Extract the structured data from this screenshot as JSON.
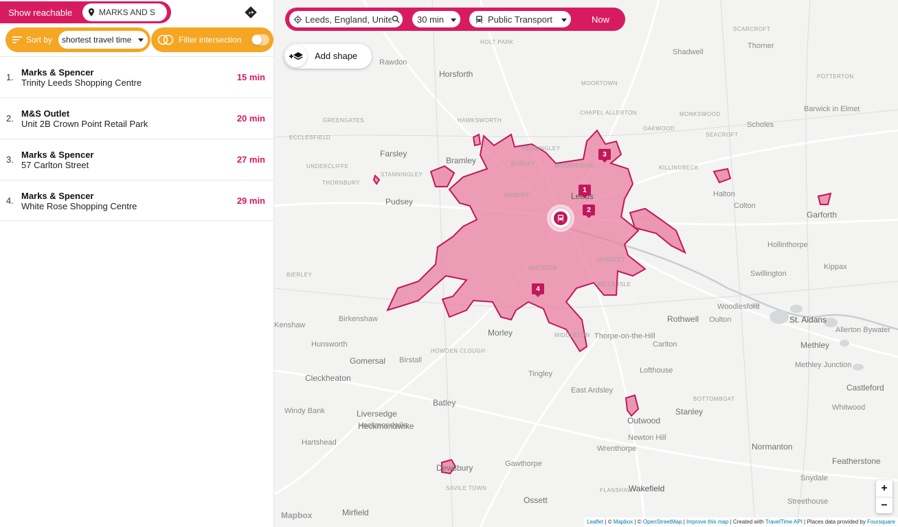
{
  "sidebar": {
    "reachable_label": "Show reachable",
    "poi_query": "MARKS AND S",
    "sort_label": "Sort by",
    "sort_value": "shortest travel time",
    "filter_label": "Filter intersection",
    "results": [
      {
        "index": "1.",
        "name": "Marks & Spencer",
        "address": "Trinity Leeds Shopping Centre",
        "time": "15 min"
      },
      {
        "index": "2.",
        "name": "M&S Outlet",
        "address": "Unit 2B Crown Point Retail Park",
        "time": "20 min"
      },
      {
        "index": "3.",
        "name": "Marks & Spencer",
        "address": "57 Carlton Street",
        "time": "27 min"
      },
      {
        "index": "4.",
        "name": "Marks & Spencer",
        "address": "White Rose Shopping Centre",
        "time": "29 min"
      }
    ]
  },
  "topbar": {
    "location": "Leeds, England, United",
    "time": "30 min",
    "mode": "Public Transport",
    "now_label": "Now"
  },
  "map": {
    "add_shape_label": "Add shape",
    "zoom_in": "+",
    "zoom_out": "−",
    "mapbox_logo": "Mapbox",
    "markers": [
      "1",
      "2",
      "3",
      "4"
    ],
    "labels": [
      {
        "t": "Horsforth",
        "c": "town"
      },
      {
        "t": "Farsley",
        "c": "town"
      },
      {
        "t": "Bramley",
        "c": "town"
      },
      {
        "t": "Pudsey",
        "c": "town"
      },
      {
        "t": "Leeds",
        "c": "big"
      },
      {
        "t": "Morley",
        "c": "town"
      },
      {
        "t": "Rothwell",
        "c": "town"
      },
      {
        "t": "Garforth",
        "c": "town"
      },
      {
        "t": "Gomersal",
        "c": "town"
      },
      {
        "t": "Cleckheaton",
        "c": "town"
      },
      {
        "t": "Batley",
        "c": "town"
      },
      {
        "t": "Liversedge",
        "c": "town"
      },
      {
        "t": "Heckmondwike",
        "c": "town"
      },
      {
        "t": "Dewsbury",
        "c": "town"
      },
      {
        "t": "Mirfield",
        "c": "town"
      },
      {
        "t": "Ossett",
        "c": "town"
      },
      {
        "t": "Wakefield",
        "c": "big"
      },
      {
        "t": "Outwood",
        "c": "town"
      },
      {
        "t": "Stanley",
        "c": "town"
      },
      {
        "t": "Normanton",
        "c": "town"
      },
      {
        "t": "Castleford",
        "c": "town"
      },
      {
        "t": "Featherstone",
        "c": "town"
      },
      {
        "t": "Methley",
        "c": "town"
      },
      {
        "t": "St. Aidans",
        "c": "big"
      },
      {
        "t": "Birkenshaw",
        "c": ""
      },
      {
        "t": "Hunsworth",
        "c": ""
      },
      {
        "t": "Birstall",
        "c": ""
      },
      {
        "t": "Tingley",
        "c": ""
      },
      {
        "t": "East Ardsley",
        "c": ""
      },
      {
        "t": "Carlton",
        "c": ""
      },
      {
        "t": "Lofthouse",
        "c": ""
      },
      {
        "t": "Thorpe-on-the-Hill",
        "c": ""
      },
      {
        "t": "Oulton",
        "c": ""
      },
      {
        "t": "Woodlesford",
        "c": ""
      },
      {
        "t": "Swillington",
        "c": ""
      },
      {
        "t": "Kippax",
        "c": ""
      },
      {
        "t": "Colton",
        "c": ""
      },
      {
        "t": "Halton",
        "c": ""
      },
      {
        "t": "Scholes",
        "c": ""
      },
      {
        "t": "Barwick in Elmet",
        "c": ""
      },
      {
        "t": "Shadwell",
        "c": ""
      },
      {
        "t": "Thorner",
        "c": ""
      },
      {
        "t": "Rawdon",
        "c": ""
      },
      {
        "t": "Hollinthorpe",
        "c": ""
      },
      {
        "t": "Allerton Bywater",
        "c": ""
      },
      {
        "t": "Whitwood",
        "c": ""
      },
      {
        "t": "Snydale",
        "c": ""
      },
      {
        "t": "Streethouse",
        "c": ""
      },
      {
        "t": "Gawthorpe",
        "c": ""
      },
      {
        "t": "Wrenthorpe",
        "c": ""
      },
      {
        "t": "Newton Hill",
        "c": ""
      },
      {
        "t": "Windy Bank",
        "c": ""
      },
      {
        "t": "Hartshead",
        "c": ""
      },
      {
        "t": "Thornbury",
        "c": "district"
      },
      {
        "t": "Stanningley",
        "c": "district"
      },
      {
        "t": "Armley",
        "c": "district"
      },
      {
        "t": "Burley",
        "c": "district"
      },
      {
        "t": "Headingley",
        "c": "district"
      },
      {
        "t": "Beeston",
        "c": "district"
      },
      {
        "t": "Hunslet",
        "c": "district"
      },
      {
        "t": "Belle Isle",
        "c": "district"
      },
      {
        "t": "Middleton",
        "c": "district"
      },
      {
        "t": "Ecclesfield",
        "c": "district"
      },
      {
        "t": "Undercliffe",
        "c": "district"
      },
      {
        "t": "Greengates",
        "c": "district"
      },
      {
        "t": "Hawksworth",
        "c": "district"
      },
      {
        "t": "Moortown",
        "c": "district"
      },
      {
        "t": "Oakwood",
        "c": "district"
      },
      {
        "t": "Seacroft",
        "c": "district"
      },
      {
        "t": "Monkswood",
        "c": "district"
      },
      {
        "t": "Killingbeck",
        "c": "district"
      },
      {
        "t": "Bierley",
        "c": "district"
      },
      {
        "t": "Howden Clough",
        "c": "district"
      },
      {
        "t": "Bottomboat",
        "c": "district"
      },
      {
        "t": "Flanshaw",
        "c": "district"
      },
      {
        "t": "Savile Town",
        "c": "district"
      },
      {
        "t": "Scarcroft",
        "c": "district"
      },
      {
        "t": "Potterton",
        "c": "district"
      },
      {
        "t": "Chapel Allerton",
        "c": "district"
      },
      {
        "t": "Holt Park",
        "c": "district"
      },
      {
        "t": "Woodhouse",
        "c": "district"
      },
      {
        "t": "Methley Junction",
        "c": ""
      },
      {
        "t": "Heckmondwike",
        "c": ""
      },
      {
        "t": "Kenshaw",
        "c": ""
      }
    ]
  },
  "attribution": {
    "leaflet": "Leaflet",
    "mapbox": "Mapbox",
    "osm": "OpenStreetMap",
    "improve": "Improve this map",
    "created_with": "Created with",
    "traveltime": "TravelTime API",
    "places": "Places data provided by",
    "foursquare": "Foursquare"
  },
  "colors": {
    "accent": "#d81b60",
    "secondary": "#f5a623",
    "isochrone_fill": "#e97fa0",
    "isochrone_stroke": "#c2185b"
  }
}
